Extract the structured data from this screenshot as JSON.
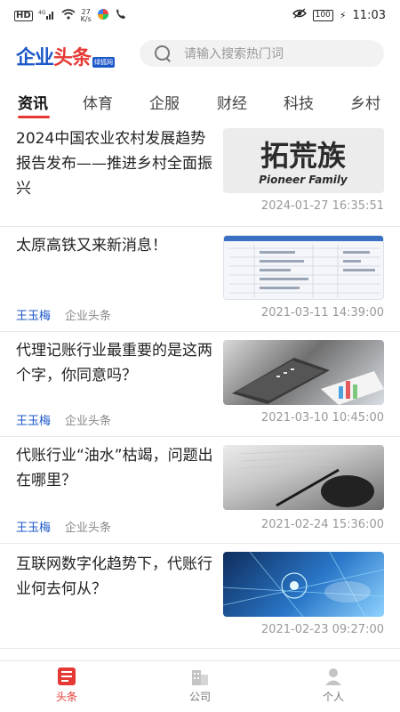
{
  "status_bar": {
    "left_indicators": [
      "HD",
      "4G",
      "27\nK/s"
    ],
    "time": "11:03",
    "battery": "100"
  },
  "header": {
    "logo_main_1": "企业",
    "logo_main_2": "头条",
    "logo_sub": "绿狐网",
    "search_placeholder": "请输入搜索热门词"
  },
  "tabs": [
    {
      "label": "资讯",
      "active": true
    },
    {
      "label": "体育",
      "active": false
    },
    {
      "label": "企服",
      "active": false
    },
    {
      "label": "财经",
      "active": false
    },
    {
      "label": "科技",
      "active": false
    },
    {
      "label": "乡村",
      "active": false
    }
  ],
  "feed": [
    {
      "title": "2024中国农业农村发展趋势报告发布——推进乡村全面振兴",
      "author": "",
      "source": "",
      "time": "2024-01-27 16:35:51",
      "thumb_text_1": "拓荒族",
      "thumb_text_2": "Pioneer Family"
    },
    {
      "title": "太原高铁又来新消息！",
      "author": "王玉梅",
      "source": "企业头条",
      "time": "2021-03-11 14:39:00"
    },
    {
      "title": "代理记账行业最重要的是这两个字，你同意吗？",
      "author": "王玉梅",
      "source": "企业头条",
      "time": "2021-03-10 10:45:00"
    },
    {
      "title": "代账行业“油水”枯竭，问题出在哪里？",
      "author": "王玉梅",
      "source": "企业头条",
      "time": "2021-02-24 15:36:00"
    },
    {
      "title": "互联网数字化趋势下，代账行业何去何从？",
      "author": "",
      "source": "",
      "time": "2021-02-23 09:27:00"
    }
  ],
  "tabbar": [
    {
      "label": "头条",
      "icon": "news-icon",
      "active": true,
      "color": "#e53935"
    },
    {
      "label": "公司",
      "icon": "company-icon",
      "active": false,
      "color": "#bdbdbd"
    },
    {
      "label": "个人",
      "icon": "person-icon",
      "active": false,
      "color": "#bdbdbd"
    }
  ]
}
